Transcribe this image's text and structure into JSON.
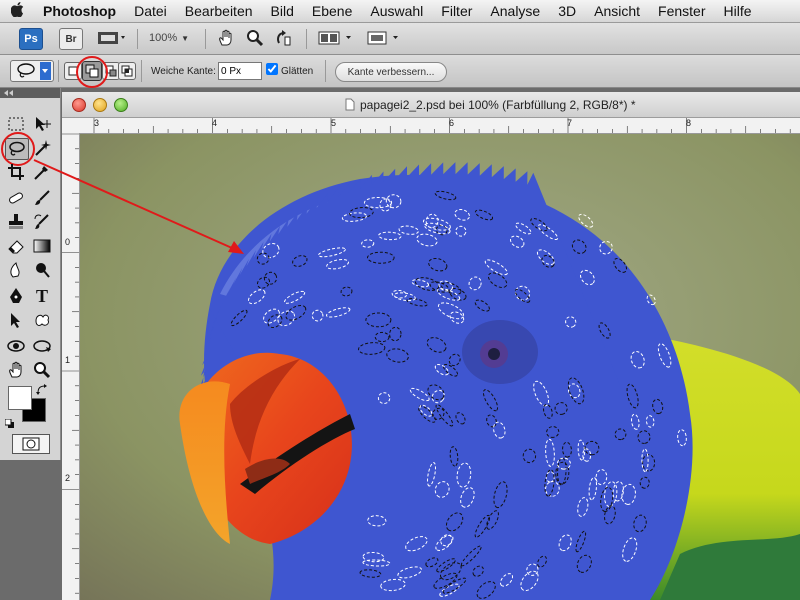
{
  "menubar": {
    "apple": "",
    "items": [
      "Photoshop",
      "Datei",
      "Bearbeiten",
      "Bild",
      "Ebene",
      "Auswahl",
      "Filter",
      "Analyse",
      "3D",
      "Ansicht",
      "Fenster",
      "Hilfe"
    ]
  },
  "appbar": {
    "ps_logo": "Ps",
    "bridge_logo": "Br",
    "zoom": "100%",
    "zoom_arrow": "▼"
  },
  "options": {
    "feather_label": "Weiche Kante:",
    "feather_value": "0 Px",
    "smooth_label": "Glätten",
    "smooth_checked": true,
    "refine_button": "Kante verbessern..."
  },
  "document": {
    "title": "papagei2_2.psd bei 100% (Farbfüllung 2, RGB/8*) *"
  },
  "rulers": {
    "h_labels": [
      "3",
      "4",
      "5",
      "6",
      "7",
      "8"
    ],
    "v_labels": [
      "0",
      "1",
      "2"
    ]
  },
  "toolbox": {
    "type_tool": "T"
  },
  "colors": {
    "selection_fill": "#3f56d0",
    "beak": "#e8451c",
    "annotation": "#e01a1a",
    "background": "#8f9a66"
  }
}
